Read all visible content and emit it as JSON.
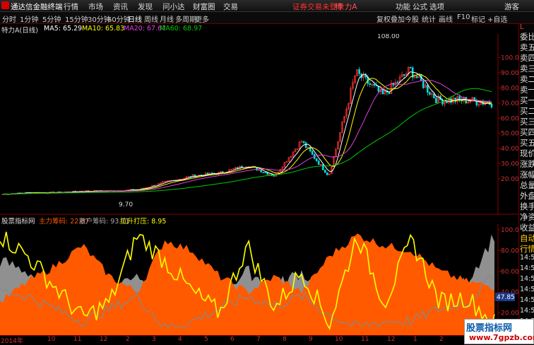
{
  "app": {
    "title": "通达信金融终端",
    "brand_color": "#d40000"
  },
  "menu": [
    "行情",
    "市场",
    "资讯",
    "发现",
    "问小达",
    "财富圈",
    "交易"
  ],
  "notice": "证券交易未登录",
  "stock_title": "特 力A",
  "right_menu": [
    "功能",
    "公式",
    "选项"
  ],
  "user": "游客",
  "periods": [
    "分时",
    "1分钟",
    "5分钟",
    "15分钟",
    "30分钟",
    "60分钟",
    "日线",
    "周线",
    "月线",
    "多周期",
    "更多"
  ],
  "active_period": "日线",
  "right_buttons": [
    "复权",
    "叠加",
    "今股",
    "统计",
    "画线",
    "F10",
    "标记",
    "+自选"
  ],
  "ma_line": {
    "title": "特力A(日线)",
    "ma5": "MA5: 65.29",
    "ma10": "MA10: 65.83",
    "ma20": "MA20: 67.67",
    "ma60": "MA60: 68.97",
    "colors": {
      "ma5": "#ffffff",
      "ma10": "#ffff00",
      "ma20": "#e040e0",
      "ma60": "#00cc00"
    }
  },
  "price_axis": [
    "100.0",
    "90.00",
    "80.00",
    "70.00",
    "60.00",
    "50.00",
    "40.00",
    "30.00",
    "20.00"
  ],
  "price_annotations": {
    "high": "108.00",
    "low": "9.70"
  },
  "indicator_line": {
    "name": "股票指标网",
    "main": "主力筹码: 22.87",
    "retail": "散户筹码: 93.71",
    "pull": "拉升打压: 8.95",
    "colors": {
      "main": "#ff5a00",
      "retail": "#999999",
      "pull": "#ffff00"
    }
  },
  "indicator_axis": [
    "100.0",
    "80.00",
    "60.00",
    "40.00",
    "20.00"
  ],
  "indicator_current": "47.85",
  "side_panel": {
    "top": "L",
    "labels": [
      "委比",
      "卖五",
      "卖四",
      "卖三",
      "卖二",
      "卖一",
      "买一",
      "买二",
      "买三",
      "买四",
      "买五",
      "现价",
      "涨跌",
      "涨幅",
      "总量",
      "外盘",
      "换手",
      "净资",
      "收益",
      "自动",
      "行情",
      "14:56",
      "14:56",
      "14:56",
      "14:56",
      "14:56",
      "14:56",
      "14:56"
    ]
  },
  "date_axis": [
    "2014年",
    "10",
    "11",
    "12",
    "2",
    "3",
    "4",
    "5",
    "6",
    "7",
    "8",
    "9",
    "10",
    "11",
    "12",
    "1",
    "2",
    "3"
  ],
  "watermark": {
    "line1": "股票指标网",
    "line2": "www.7gpzb.com"
  },
  "chart_data": [
    {
      "type": "candlestick",
      "title": "特力A(日线)",
      "ylim": [
        0,
        110
      ],
      "x": [
        "2014-09",
        "2014-10",
        "2014-11",
        "2014-12",
        "2015-01",
        "2015-02",
        "2015-03",
        "2015-04",
        "2015-05",
        "2015-06",
        "2015-07",
        "2015-08",
        "2015-09",
        "2015-10",
        "2015-11",
        "2015-12",
        "2016-01",
        "2016-02",
        "2016-03"
      ],
      "series": [
        {
          "name": "close",
          "values": [
            10,
            11,
            11,
            12,
            12,
            13,
            18,
            22,
            24,
            29,
            22,
            45,
            22,
            90,
            75,
            92,
            72,
            72,
            70
          ]
        },
        {
          "name": "MA60",
          "values": [
            10,
            10,
            10.5,
            11,
            11.5,
            12,
            14,
            17,
            20,
            22,
            23,
            28,
            30,
            45,
            55,
            75,
            75,
            70,
            69
          ]
        }
      ],
      "annotations": [
        "108.00",
        "9.70"
      ]
    },
    {
      "type": "area",
      "series": [
        {
          "name": "主力筹码",
          "values": [
            30,
            50,
            65,
            85,
            55,
            40,
            90,
            80,
            55,
            40,
            55,
            40,
            75,
            95,
            85,
            80,
            60,
            50,
            45
          ]
        },
        {
          "name": "散户筹码",
          "values": [
            70,
            60,
            40,
            20,
            40,
            60,
            10,
            20,
            40,
            60,
            45,
            60,
            30,
            10,
            20,
            20,
            40,
            50,
            95
          ]
        },
        {
          "name": "拉升打压",
          "values": [
            95,
            75,
            45,
            15,
            30,
            95,
            70,
            40,
            20,
            85,
            25,
            60,
            10,
            95,
            30,
            90,
            30,
            35,
            10
          ]
        }
      ],
      "ylim": [
        0,
        100
      ]
    }
  ]
}
